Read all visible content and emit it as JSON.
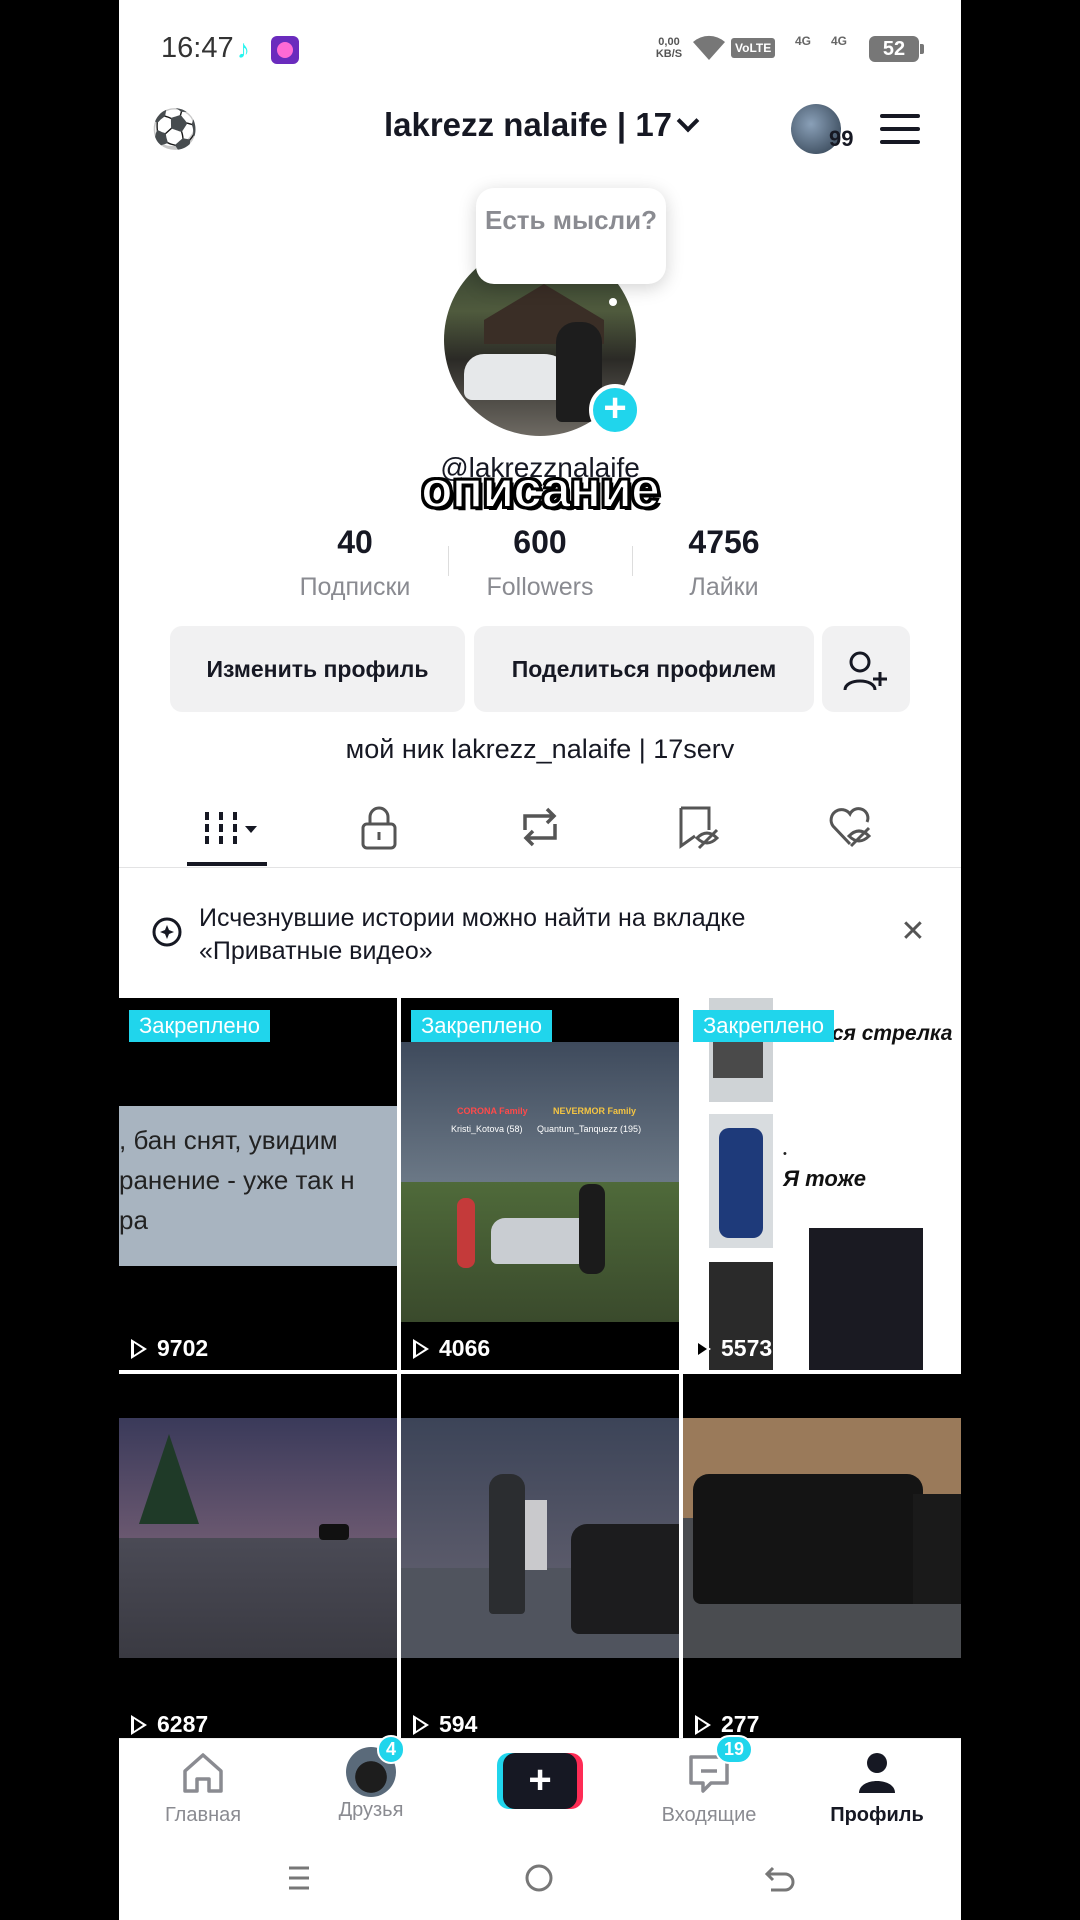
{
  "status_bar": {
    "time": "16:47",
    "net_speed_value": "0,00",
    "net_speed_unit": "KB/S",
    "volte": "VoLTE",
    "sim1": "4G",
    "sim2": "4G",
    "battery": "52"
  },
  "header": {
    "username": "lakrezz nalaife | 17",
    "friends_count_badge": "99"
  },
  "profile": {
    "bubble_text": "Есть мысли?",
    "handle": "@lakrezznalaife",
    "overlay_caption": "описание",
    "stats": [
      {
        "value": "40",
        "label": "Подписки"
      },
      {
        "value": "600",
        "label": "Followers"
      },
      {
        "value": "4756",
        "label": "Лайки"
      }
    ],
    "edit_button": "Изменить профиль",
    "share_button": "Поделиться профилем",
    "bio": "мой ник lakrezz_nalaife | 17serv"
  },
  "tabs": [
    "videos",
    "private",
    "reposts",
    "favorites",
    "liked"
  ],
  "banner": {
    "text": "Исчезнувшие истории можно найти на вкладке «Приватные видео»"
  },
  "videos": [
    {
      "pinned": "Закреплено",
      "views": "9702",
      "caption_lines": [
        ", бан снят, увидим",
        "ранение - уже так н",
        "ра"
      ]
    },
    {
      "pinned": "Закреплено",
      "views": "4066",
      "tags": [
        "CORONA Family",
        "NEVERMOR Family",
        "Kristi_Kotova (58)",
        "Quantum_Tanquezz (195)"
      ]
    },
    {
      "pinned": "Закреплено",
      "views": "5573",
      "meme_lines": [
        "и вся стрелка",
        "Я тоже"
      ]
    },
    {
      "views": "6287"
    },
    {
      "views": "594"
    },
    {
      "views": "277"
    }
  ],
  "bottom_nav": {
    "home": "Главная",
    "friends": "Друзья",
    "friends_badge": "4",
    "inbox": "Входящие",
    "inbox_badge": "19",
    "profile": "Профиль"
  },
  "colors": {
    "accent_cyan": "#20d5ec",
    "accent_red": "#fe2c55",
    "text_dark": "#161823",
    "text_gray": "#8a8b91"
  }
}
